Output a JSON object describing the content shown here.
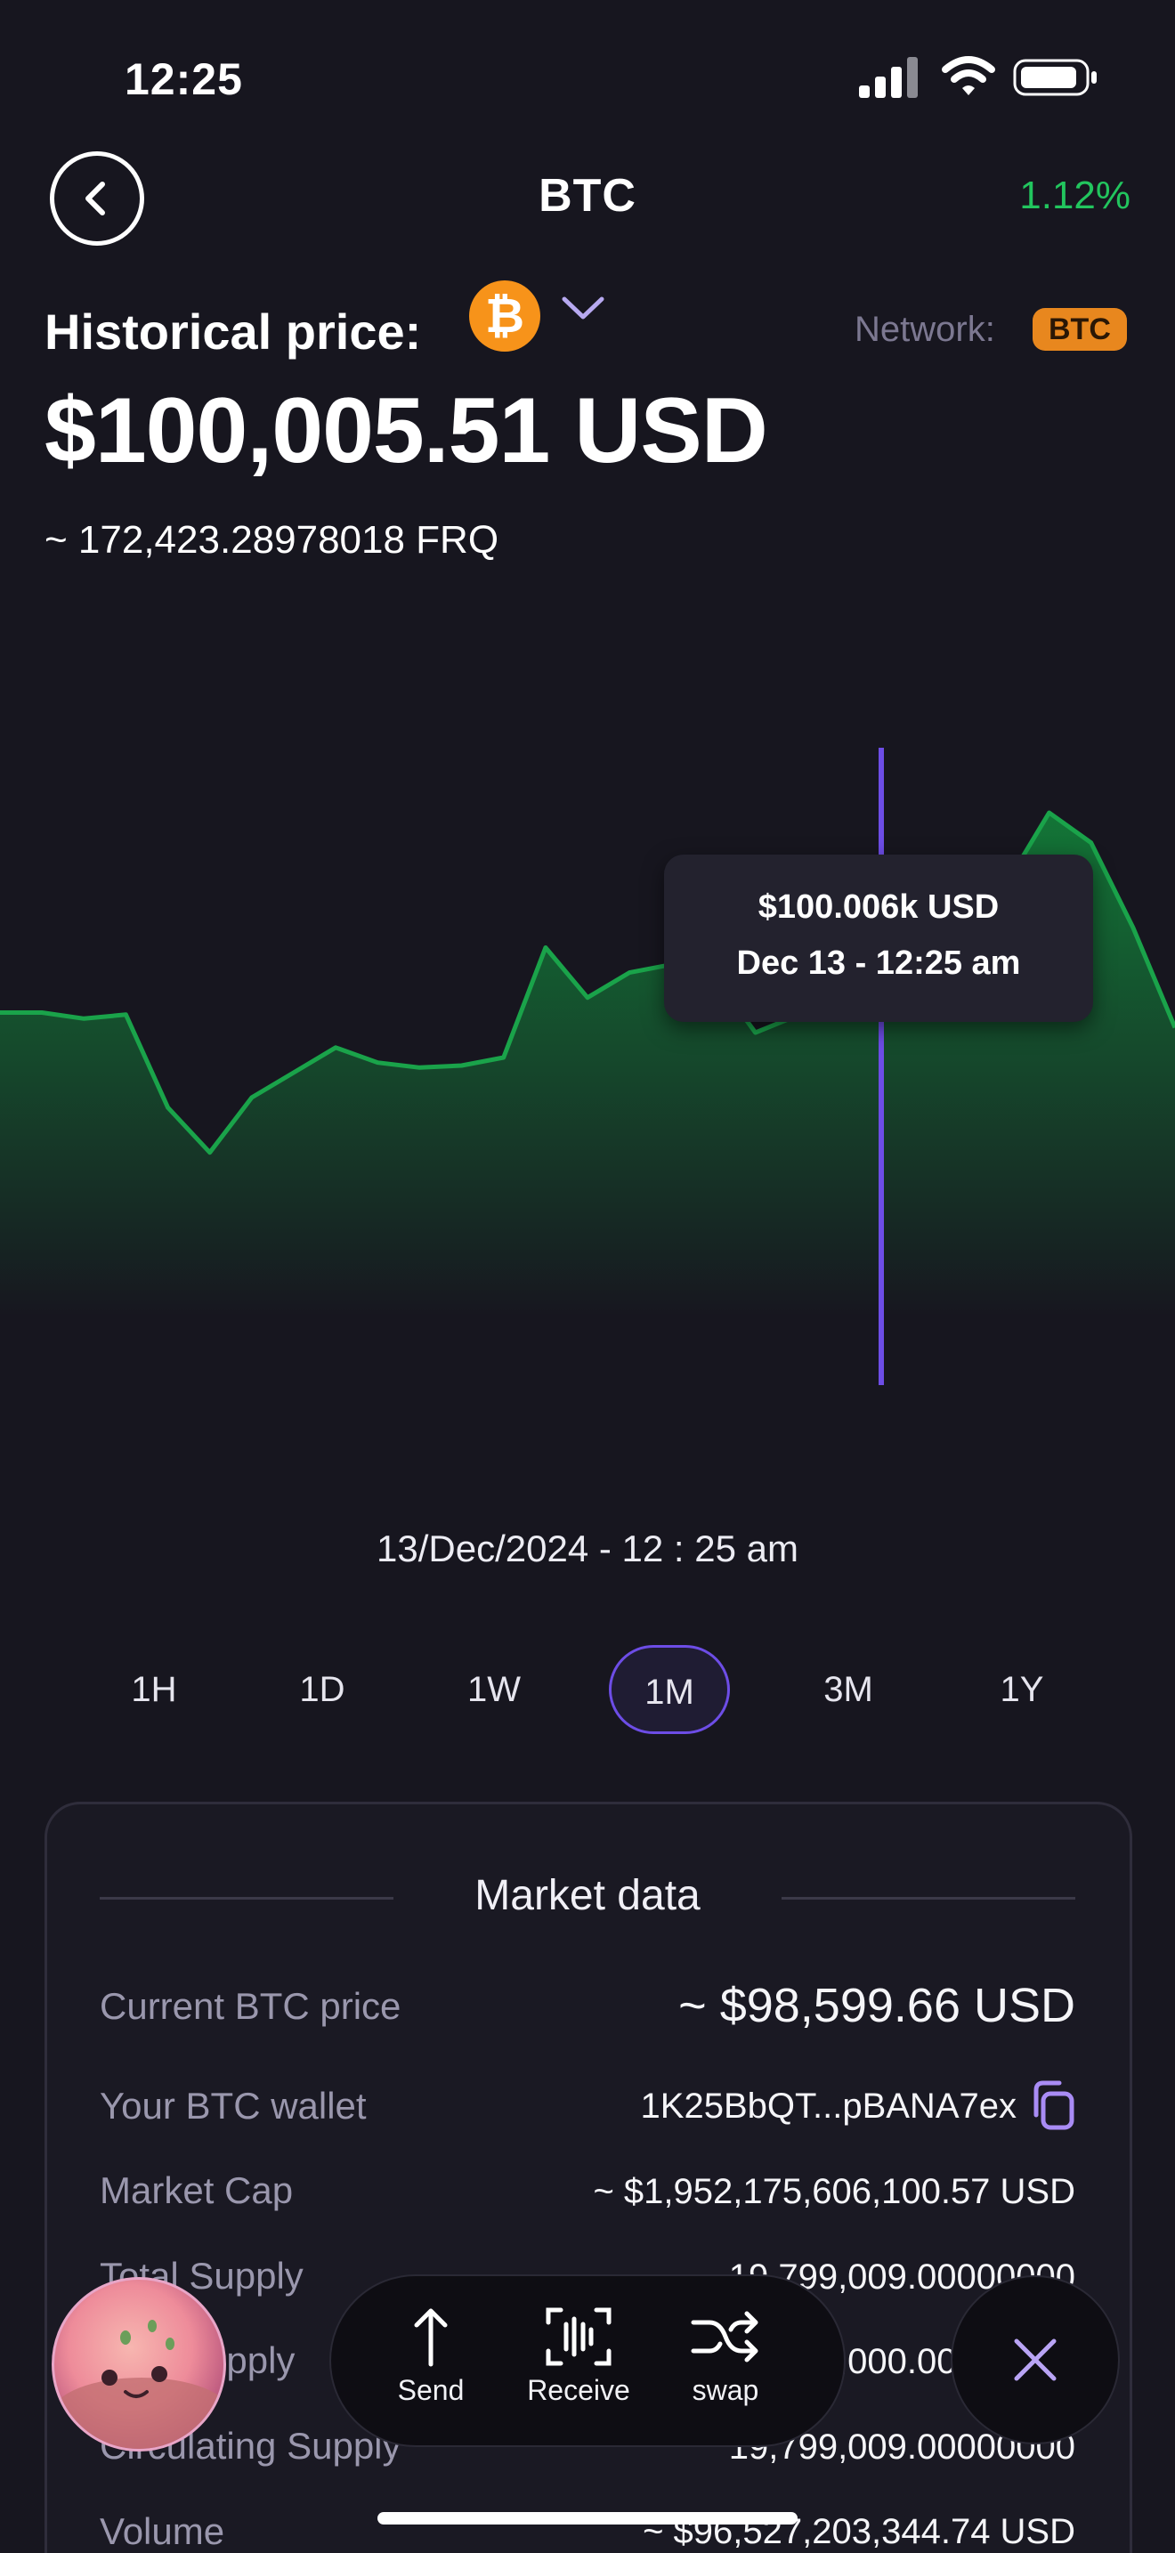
{
  "status_bar": {
    "time": "12:25"
  },
  "header": {
    "title": "BTC",
    "change": "1.12%"
  },
  "price_section": {
    "historical_label": "Historical price:",
    "network_label": "Network:",
    "network_badge": "BTC",
    "price": "$100,005.51 USD",
    "converted": "~ 172,423.28978018 FRQ"
  },
  "chart_data": {
    "type": "area",
    "x": [
      0,
      1,
      2,
      3,
      4,
      5,
      6,
      7,
      8,
      9,
      10,
      11,
      12,
      13,
      14,
      15,
      16,
      17,
      18,
      19,
      20,
      21,
      22,
      23,
      24,
      25,
      26,
      27,
      28
    ],
    "values": [
      99.25,
      99.25,
      99.19,
      99.23,
      98.3,
      97.85,
      98.4,
      98.65,
      98.9,
      98.75,
      98.7,
      98.72,
      98.8,
      99.9,
      99.4,
      99.65,
      99.73,
      99.63,
      99.05,
      99.22,
      99.8,
      99.73,
      100.01,
      100.35,
      100.55,
      101.25,
      100.95,
      100.1,
      99.1
    ],
    "colors": {
      "line": "#1aa34a",
      "fill_top": "#137a38",
      "fill_bottom": "#17161f",
      "cursor": "#6d4de6"
    },
    "cursor_index": 21,
    "tooltip": {
      "value": "$100.006k USD",
      "time": "Dec 13  -  12:25 am"
    }
  },
  "selected_datetime": "13/Dec/2024  -  12 : 25 am",
  "timeframes": [
    {
      "label": "1H"
    },
    {
      "label": "1D"
    },
    {
      "label": "1W"
    },
    {
      "label": "1M",
      "active": true
    },
    {
      "label": "3M"
    },
    {
      "label": "1Y"
    }
  ],
  "market_data": {
    "title": "Market data",
    "rows": [
      {
        "label": "Current BTC price",
        "value": "~ $98,599.66 USD"
      },
      {
        "label": "Your BTC wallet",
        "value": "1K25BbQT...pBANA7ex"
      },
      {
        "label": "Market Cap",
        "value": "~ $1,952,175,606,100.57 USD"
      },
      {
        "label": "Total Supply",
        "value": "19,799,009.00000000"
      },
      {
        "label": "Max Supply",
        "value": "21,000,000.00000000"
      },
      {
        "label": "Circulating Supply",
        "value": "19,799,009.00000000"
      },
      {
        "label": "Volume",
        "value": "~ $96,527,203,344.74 USD"
      }
    ]
  },
  "action_bar": {
    "send": "Send",
    "receive": "Receive",
    "swap": "swap"
  },
  "icons": [
    "back-arrow-icon",
    "bitcoin-icon",
    "chevron-down-icon",
    "copy-icon",
    "send-arrow-icon",
    "receive-scan-icon",
    "swap-shuffle-icon",
    "close-icon",
    "signal-icon",
    "wifi-icon",
    "battery-icon"
  ]
}
